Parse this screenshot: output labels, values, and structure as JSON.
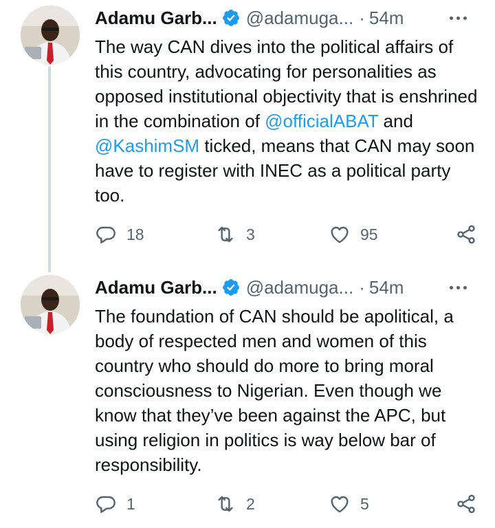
{
  "tweets": [
    {
      "author_name": "Adamu Garb...",
      "handle": "@adamuga...",
      "separator": "·",
      "time": "54m",
      "text": [
        {
          "t": "The way CAN dives into the political affairs of this country, advocating for personalities as opposed institutional objectivity that is enshrined in the combination of ",
          "m": false
        },
        {
          "t": "@officialABAT",
          "m": true
        },
        {
          "t": " and ",
          "m": false
        },
        {
          "t": "@KashimSM",
          "m": true
        },
        {
          "t": " ticked, means that CAN may soon have to register with INEC as a political party too.",
          "m": false
        }
      ],
      "replies": "18",
      "retweets": "3",
      "likes": "95"
    },
    {
      "author_name": "Adamu Garb...",
      "handle": "@adamuga...",
      "separator": "·",
      "time": "54m",
      "text": [
        {
          "t": "The foundation of CAN should be apolitical, a body of respected men and women of this country who should do more to bring moral consciousness to Nigerian. Even though we know that they’ve been against the APC, but using religion in politics is way below bar of responsibility.",
          "m": false
        }
      ],
      "replies": "1",
      "retweets": "2",
      "likes": "5"
    }
  ],
  "icons": {
    "verified": "verified-badge-icon",
    "more": "more-dots-icon",
    "reply": "reply-bubble-icon",
    "retweet": "retweet-icon",
    "like": "heart-icon",
    "share": "share-icon"
  },
  "colors": {
    "text": "#0f1419",
    "secondary": "#536471",
    "mention": "#1d9bf0",
    "verified": "#1d9bf0",
    "thread_line": "#cfd9de"
  }
}
